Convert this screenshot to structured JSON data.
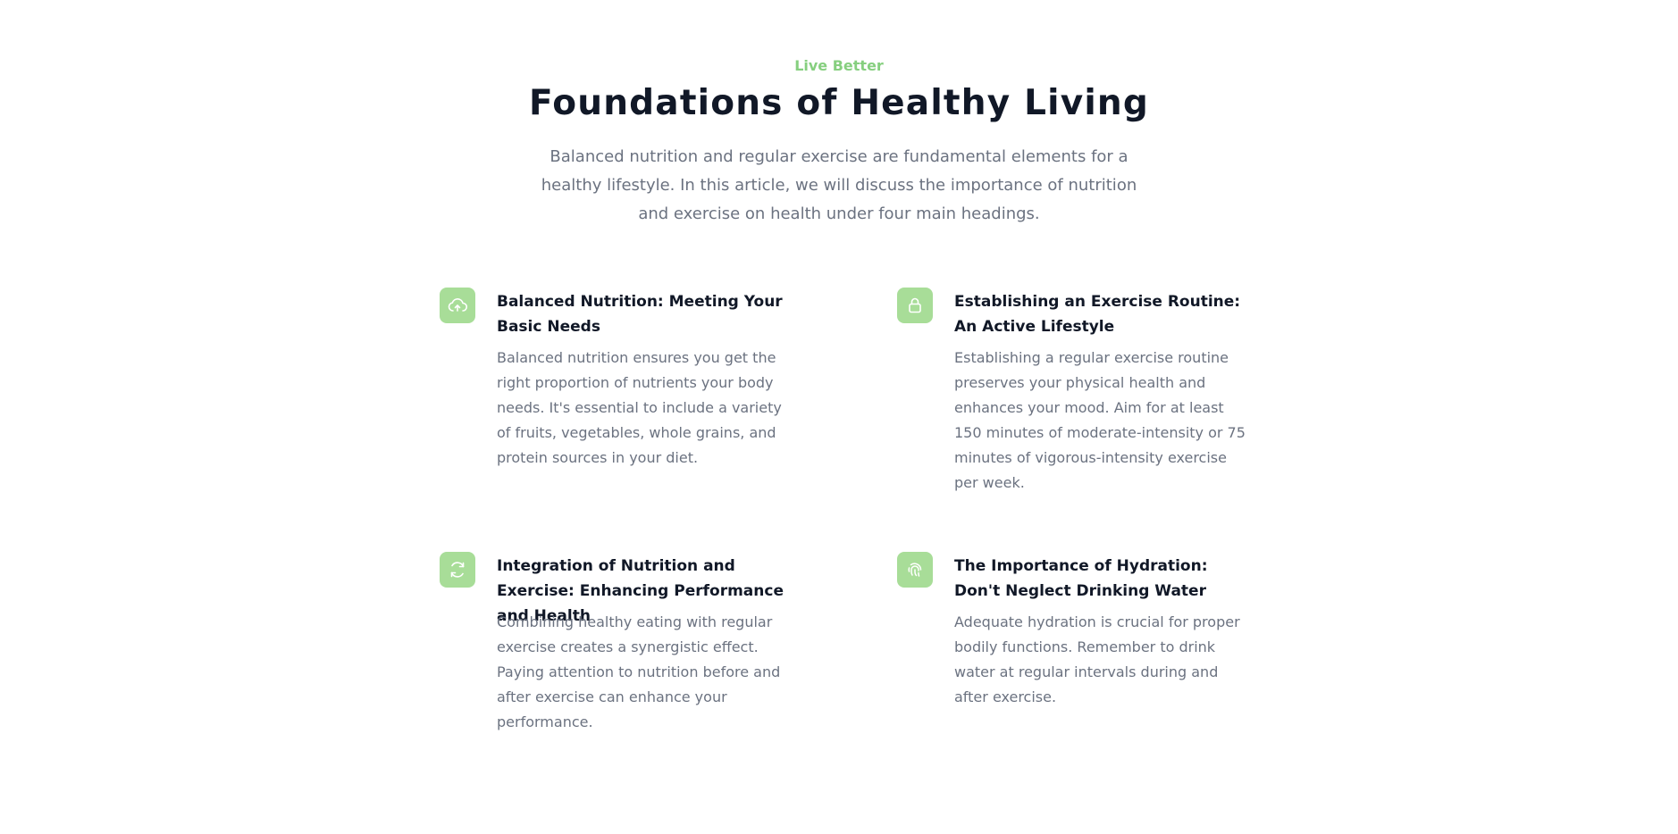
{
  "header": {
    "eyebrow": "Live Better",
    "title": "Foundations of Healthy Living",
    "intro": "Balanced nutrition and regular exercise are fundamental elements for a healthy lifestyle. In this article, we will discuss the importance of nutrition and exercise on health under four main headings."
  },
  "features": [
    {
      "icon": "cloud-upload-icon",
      "title": "Balanced Nutrition: Meeting Your Basic Needs",
      "text": "Balanced nutrition ensures you get the right proportion of nutrients your body needs. It's essential to include a variety of fruits, vegetables, whole grains, and protein sources in your diet."
    },
    {
      "icon": "lock-icon",
      "title": "Establishing an Exercise Routine: An Active Lifestyle",
      "text": "Establishing a regular exercise routine preserves your physical health and enhances your mood. Aim for at least 150 minutes of moderate-intensity or 75 minutes of vigorous-intensity exercise per week."
    },
    {
      "icon": "refresh-icon",
      "title": "Integration of Nutrition and Exercise: Enhancing Performance and Health",
      "text": "Combining healthy eating with regular exercise creates a synergistic effect. Paying attention to nutrition before and after exercise can enhance your performance."
    },
    {
      "icon": "fingerprint-icon",
      "title": "The Importance of Hydration: Don't Neglect Drinking Water",
      "text": "Adequate hydration is crucial for proper bodily functions. Remember to drink water at regular intervals during and after exercise."
    }
  ],
  "colors": {
    "accent": "#a8dd98",
    "eyebrow": "#86cf7f",
    "heading": "#111827",
    "body": "#6b7280"
  }
}
